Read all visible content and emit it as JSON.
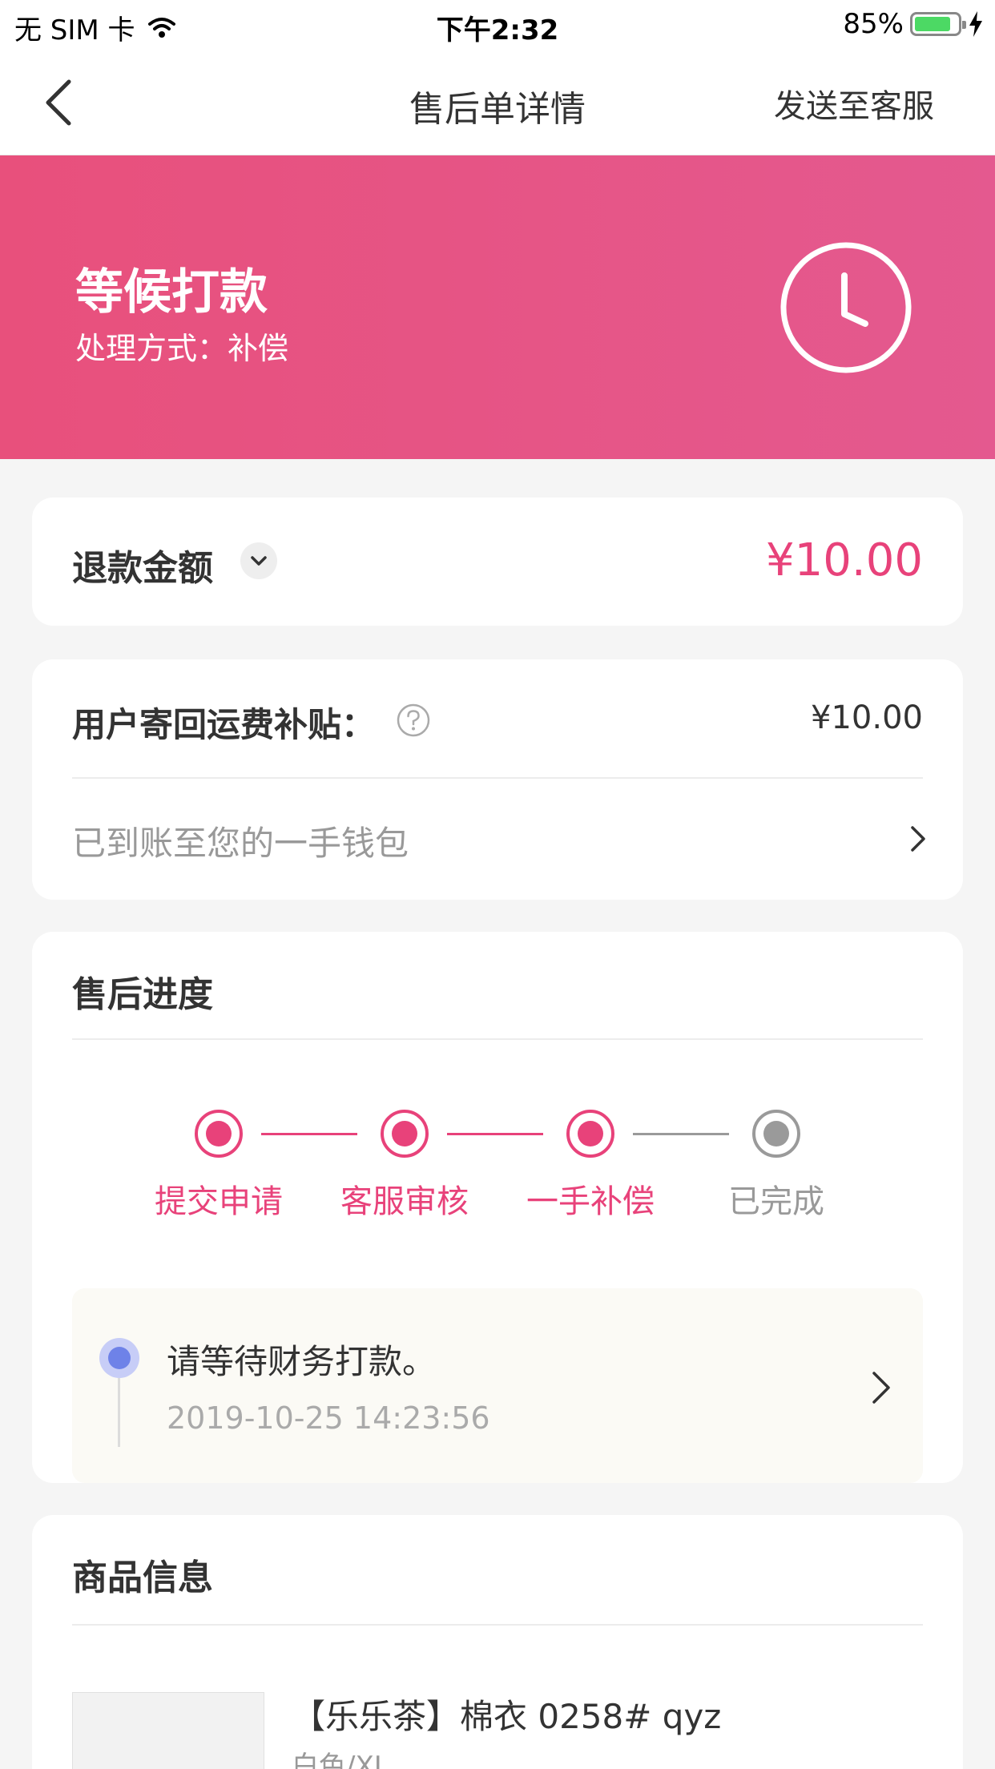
{
  "status_bar": {
    "carrier": "无 SIM 卡",
    "time": "下午2:32",
    "battery": "85%",
    "battery_level": 0.85
  },
  "nav": {
    "title": "售后单详情",
    "action": "发送至客服"
  },
  "banner": {
    "title": "等候打款",
    "subtitle": "处理方式：补偿",
    "color": "#e6568a"
  },
  "refund": {
    "label": "退款金额",
    "amount": "¥10.00",
    "accent": "#e8427a"
  },
  "subsidy": {
    "label": "用户寄回运费补贴：",
    "amount": "¥10.00",
    "wallet_text": "已到账至您的一手钱包"
  },
  "progress": {
    "title": "售后进度",
    "steps": [
      {
        "label": "提交申请",
        "state": "done"
      },
      {
        "label": "客服审核",
        "state": "done"
      },
      {
        "label": "一手补偿",
        "state": "current"
      },
      {
        "label": "已完成",
        "state": "pending"
      }
    ],
    "log": {
      "text": "请等待财务打款。",
      "time": "2019-10-25 14:23:56"
    }
  },
  "product": {
    "title": "商品信息",
    "name": "【乐乐茶】棉衣 0258# qyz",
    "spec": "白色/XL"
  }
}
